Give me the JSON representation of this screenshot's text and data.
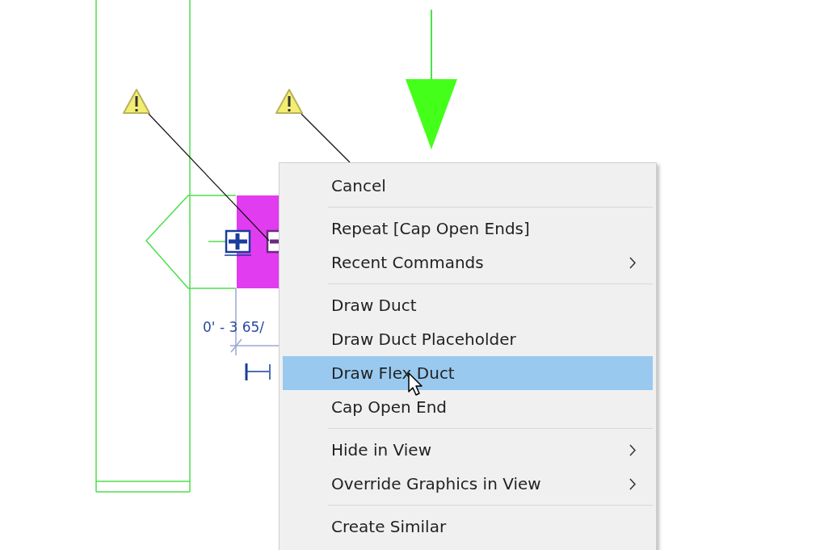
{
  "canvas": {
    "dimension_text": "0' - 3 65/"
  },
  "context_menu": {
    "groups": [
      [
        {
          "label": "Cancel",
          "selected": false,
          "submenu": false
        }
      ],
      [
        {
          "label": "Repeat [Cap Open Ends]",
          "selected": false,
          "submenu": false
        },
        {
          "label": "Recent Commands",
          "selected": false,
          "submenu": true
        }
      ],
      [
        {
          "label": "Draw Duct",
          "selected": false,
          "submenu": false
        },
        {
          "label": "Draw Duct Placeholder",
          "selected": false,
          "submenu": false
        },
        {
          "label": "Draw Flex Duct",
          "selected": true,
          "submenu": false
        },
        {
          "label": "Cap Open End",
          "selected": false,
          "submenu": false
        }
      ],
      [
        {
          "label": "Hide in View",
          "selected": false,
          "submenu": true
        },
        {
          "label": "Override Graphics in View",
          "selected": false,
          "submenu": true
        }
      ],
      [
        {
          "label": "Create Similar",
          "selected": false,
          "submenu": false
        }
      ]
    ]
  }
}
